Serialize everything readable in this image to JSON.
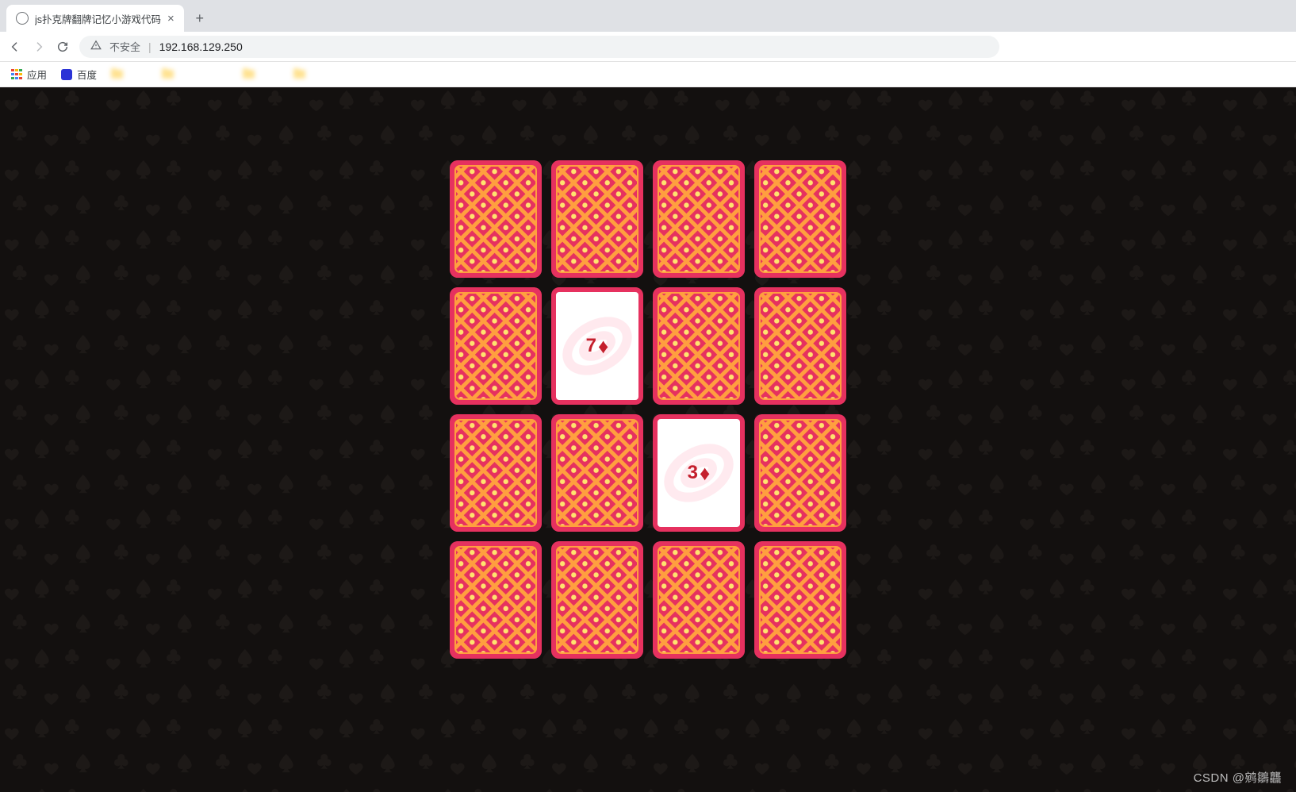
{
  "browser": {
    "tab_title": "js扑克牌翻牌记忆小游戏代码",
    "tab_close_glyph": "×",
    "newtab_glyph": "+",
    "security_label": "不安全",
    "security_sep": "|",
    "url": "192.168.129.250",
    "bookmarks": {
      "apps": "应用",
      "baidu": "百度"
    }
  },
  "game": {
    "grid_cols": 4,
    "grid_rows": 4,
    "cards": [
      {
        "row": 0,
        "col": 0,
        "side": "back"
      },
      {
        "row": 0,
        "col": 1,
        "side": "back"
      },
      {
        "row": 0,
        "col": 2,
        "side": "back"
      },
      {
        "row": 0,
        "col": 3,
        "side": "back"
      },
      {
        "row": 1,
        "col": 0,
        "side": "back"
      },
      {
        "row": 1,
        "col": 1,
        "side": "face",
        "rank": "7",
        "suit": "diamond",
        "suit_glyph": "♦",
        "color": "#c4202d"
      },
      {
        "row": 1,
        "col": 2,
        "side": "back"
      },
      {
        "row": 1,
        "col": 3,
        "side": "back"
      },
      {
        "row": 2,
        "col": 0,
        "side": "back"
      },
      {
        "row": 2,
        "col": 1,
        "side": "back"
      },
      {
        "row": 2,
        "col": 2,
        "side": "face",
        "rank": "3",
        "suit": "diamond",
        "suit_glyph": "♦",
        "color": "#c4202d"
      },
      {
        "row": 2,
        "col": 3,
        "side": "back"
      },
      {
        "row": 3,
        "col": 0,
        "side": "back"
      },
      {
        "row": 3,
        "col": 1,
        "side": "back"
      },
      {
        "row": 3,
        "col": 2,
        "side": "back"
      },
      {
        "row": 3,
        "col": 3,
        "side": "back"
      }
    ]
  },
  "colors": {
    "card_back": "#e6315f",
    "card_back_accent1": "#ff9f3f",
    "card_back_accent2": "#ffe36e",
    "page_bg": "#13100f",
    "suit_pattern": "#1c1817"
  },
  "watermark": "CSDN @鹓鶵龘"
}
